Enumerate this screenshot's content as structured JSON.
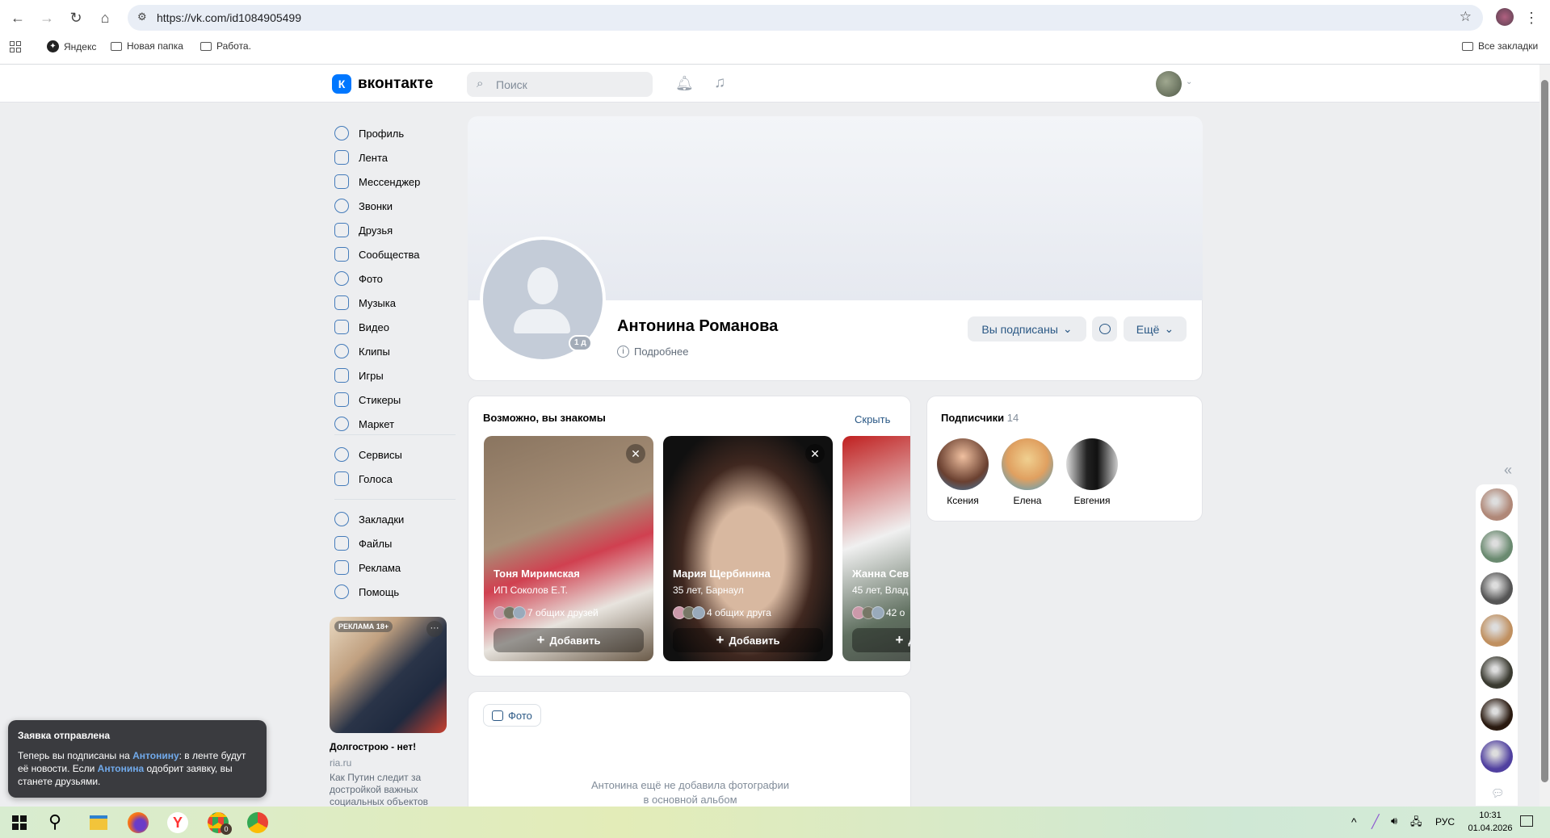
{
  "browser": {
    "url": "https://vk.com/id1084905499",
    "bookmarks": [
      "Яндекс",
      "Новая папка",
      "Работа."
    ],
    "all_bookmarks": "Все закладки"
  },
  "header": {
    "logo_text": "вконтакте",
    "search_placeholder": "Поиск",
    "accent": "#0077ff"
  },
  "sidebar": {
    "items": [
      "Профиль",
      "Лента",
      "Мессенджер",
      "Звонки",
      "Друзья",
      "Сообщества",
      "Фото",
      "Музыка",
      "Видео",
      "Клипы",
      "Игры",
      "Стикеры",
      "Маркет"
    ],
    "items2": [
      "Сервисы",
      "Голоса"
    ],
    "items3": [
      "Закладки",
      "Файлы",
      "Реклама",
      "Помощь"
    ]
  },
  "ad": {
    "badge": "РЕКЛАМА 18+",
    "title": "Долгострою - нет!",
    "source": "ria.ru",
    "text": "Как Путин следит за достройкой важных социальных объектов"
  },
  "profile": {
    "name": "Антонина Романова",
    "online_badge": "1 д",
    "details_link": "Подробнее",
    "subscribed_button": "Вы подписаны",
    "more_button": "Ещё"
  },
  "suggestions": {
    "title": "Возможно, вы знакомы",
    "hide": "Скрыть",
    "add_label": "Добавить",
    "people": [
      {
        "name": "Тоня Миримская",
        "sub": "ИП Соколов Е.Т.",
        "mutual": "7 общих друзей"
      },
      {
        "name": "Мария Щербинина",
        "sub": "35 лет, Барнаул",
        "mutual": "4 общих друга"
      },
      {
        "name": "Жанна Сев",
        "sub": "45 лет, Влад",
        "mutual": "42 о"
      }
    ]
  },
  "followers": {
    "title": "Подписчики",
    "count": "14",
    "people": [
      "Ксения",
      "Елена",
      "Евгения"
    ]
  },
  "photos": {
    "tab": "Фото",
    "empty_line1": "Антонина ещё не добавила фотографии",
    "empty_line2": "в основной альбом"
  },
  "toast": {
    "title": "Заявка отправлена",
    "p1": "Теперь вы подписаны на ",
    "link1": "Антонину",
    "p2": ": в ленте будут её новости. Если ",
    "link2": "Антонина",
    "p3": " одобрит заявку, вы станете друзьями."
  },
  "taskbar": {
    "lang": "РУС",
    "time": "10:31",
    "date": "01.04.2026",
    "chrome_badge": "0"
  }
}
